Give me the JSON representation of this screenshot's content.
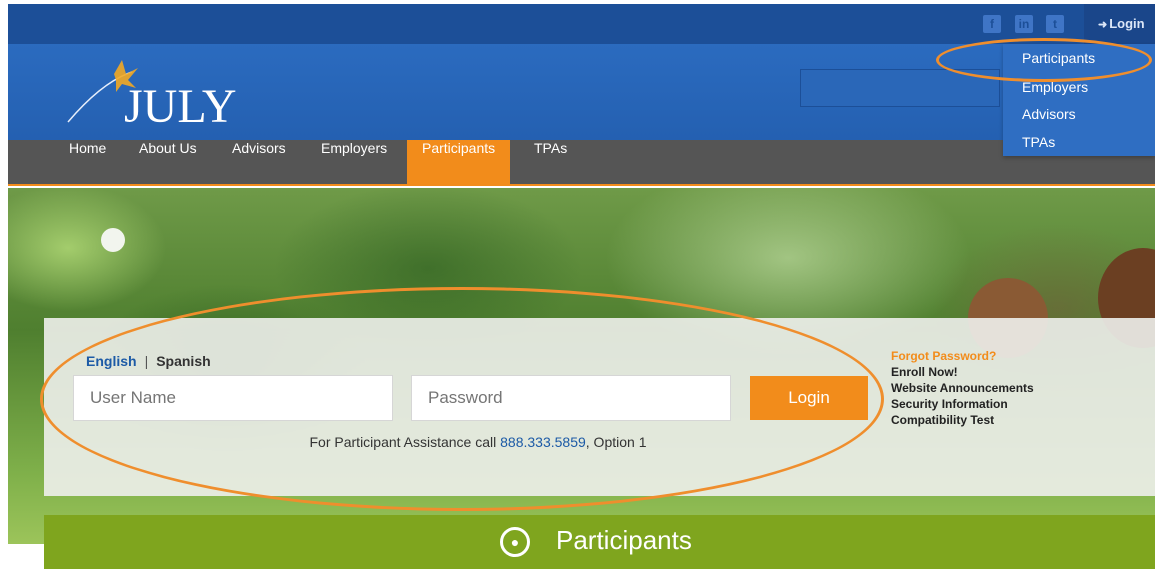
{
  "brand": {
    "logo_text": "JULY"
  },
  "social": [
    {
      "name": "facebook-icon",
      "glyph": "f"
    },
    {
      "name": "linkedin-icon",
      "glyph": "in"
    },
    {
      "name": "twitter-icon",
      "glyph": "t"
    }
  ],
  "topbar": {
    "login_label": "Login"
  },
  "nav": {
    "items": [
      {
        "label": "Home"
      },
      {
        "label": "About Us"
      },
      {
        "label": "Advisors"
      },
      {
        "label": "Employers"
      },
      {
        "label": "Participants"
      },
      {
        "label": "TPAs"
      }
    ],
    "active": "Participants"
  },
  "login_dropdown": {
    "items": [
      {
        "label": "Participants"
      },
      {
        "label": "Employers"
      },
      {
        "label": "Advisors"
      },
      {
        "label": "TPAs"
      }
    ]
  },
  "login_panel": {
    "lang_english": "English",
    "lang_separator": "|",
    "lang_spanish": "Spanish",
    "username_placeholder": "User Name",
    "password_placeholder": "Password",
    "login_button": "Login",
    "assist_prefix": "For Participant Assistance call",
    "assist_phone": "888.333.5859",
    "assist_suffix": ", Option 1"
  },
  "side_links": {
    "forgot": "Forgot Password?",
    "enroll": "Enroll Now!",
    "announcements": "Website Announcements",
    "security": "Security Information",
    "compatibility": "Compatibility Test"
  },
  "banner": {
    "title": "Participants"
  },
  "colors": {
    "accent_orange": "#f28c1b",
    "header_blue": "#2460b1",
    "topbar_blue": "#1c4f98",
    "nav_gray": "#555555",
    "banner_green": "#7fa51e",
    "link_blue": "#1c5aa6"
  }
}
